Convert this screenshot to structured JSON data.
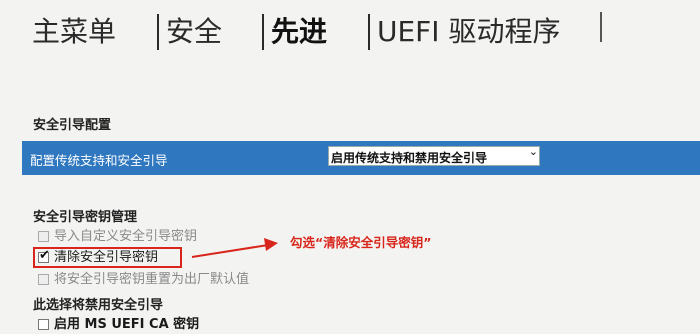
{
  "tabs": [
    {
      "label": "主菜单",
      "active": false
    },
    {
      "label": "安全",
      "active": false
    },
    {
      "label": "先进",
      "active": true
    },
    {
      "label": "UEFI 驱动程序",
      "active": false
    }
  ],
  "secure_boot_config": {
    "title": "安全引导配置",
    "legacy_setting": {
      "label": "配置传统支持和安全引导",
      "value": "启用传统支持和禁用安全引导"
    }
  },
  "key_management": {
    "title": "安全引导密钥管理",
    "options": [
      {
        "label": "导入自定义安全引导密钥",
        "checked": false,
        "enabled": false
      },
      {
        "label": "清除安全引导密钥",
        "checked": true,
        "enabled": true
      },
      {
        "label": "将安全引导密钥重置为出厂默认值",
        "checked": false,
        "enabled": false
      }
    ]
  },
  "disable_section": {
    "title": "此选择将禁用安全引导",
    "options": [
      {
        "label": "启用 MS UEFI CA 密钥",
        "checked": false,
        "enabled": true
      }
    ]
  },
  "annotation": {
    "text": "勾选“清除安全引导密钥”",
    "color": "#d9261c"
  },
  "colors": {
    "accent": "#2f78bf",
    "background": "#f3f3f1"
  }
}
